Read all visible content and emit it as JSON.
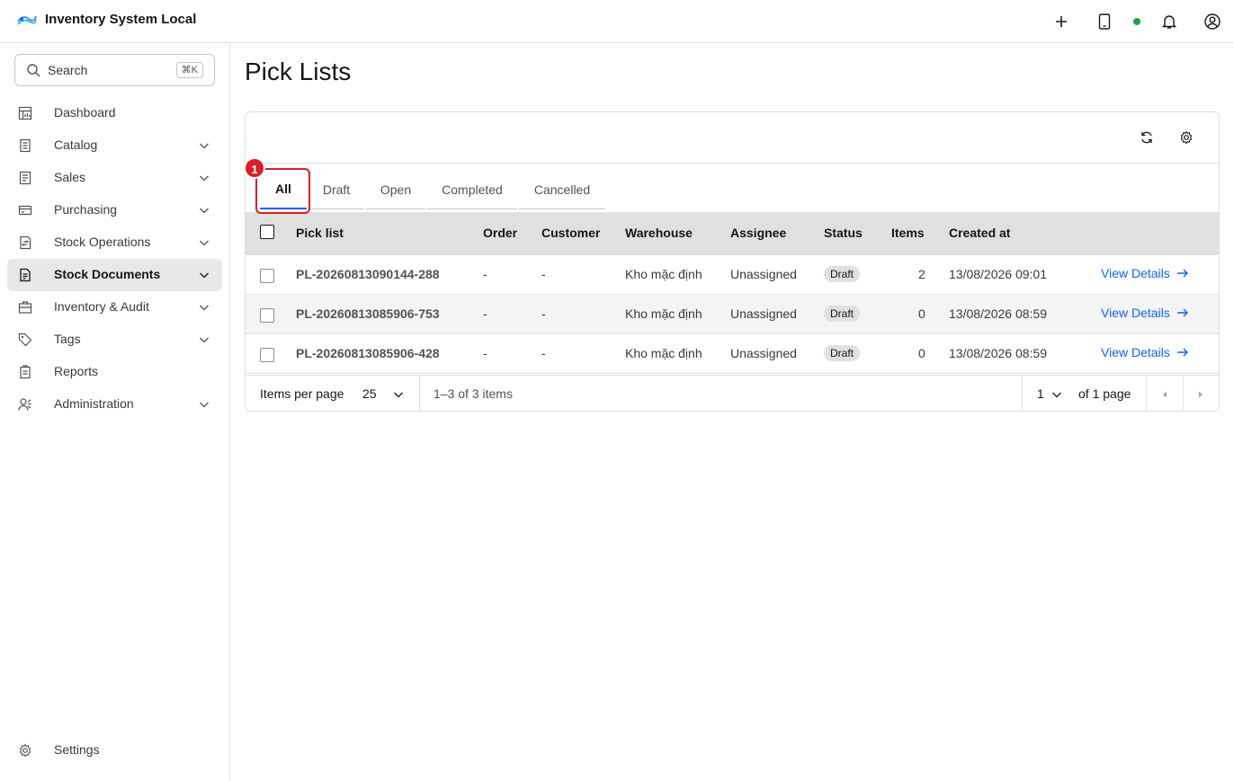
{
  "header": {
    "title": "Inventory System Local",
    "icons": [
      "plus-icon",
      "tablet-icon",
      "notification-icon",
      "user-avatar-icon"
    ],
    "status_color": "#24a148"
  },
  "sidebar": {
    "search": {
      "label": "Search",
      "shortcut": "⌘K"
    },
    "items": [
      {
        "label": "Dashboard",
        "icon": "dashboard-icon",
        "expandable": false
      },
      {
        "label": "Catalog",
        "icon": "catalog-icon",
        "expandable": true
      },
      {
        "label": "Sales",
        "icon": "sales-icon",
        "expandable": true
      },
      {
        "label": "Purchasing",
        "icon": "purchasing-icon",
        "expandable": true
      },
      {
        "label": "Stock Operations",
        "icon": "stock-operations-icon",
        "expandable": true
      },
      {
        "label": "Stock Documents",
        "icon": "stock-documents-icon",
        "expandable": true,
        "active": true
      },
      {
        "label": "Inventory & Audit",
        "icon": "inventory-audit-icon",
        "expandable": true
      },
      {
        "label": "Tags",
        "icon": "tag-icon",
        "expandable": true
      },
      {
        "label": "Reports",
        "icon": "reports-icon",
        "expandable": false
      },
      {
        "label": "Administration",
        "icon": "administration-icon",
        "expandable": true
      }
    ],
    "settings_label": "Settings"
  },
  "main": {
    "title": "Pick Lists",
    "annotation_number": "1",
    "tabs": [
      {
        "label": "All",
        "active": true
      },
      {
        "label": "Draft"
      },
      {
        "label": "Open"
      },
      {
        "label": "Completed"
      },
      {
        "label": "Cancelled"
      }
    ],
    "columns": [
      "Pick list",
      "Order",
      "Customer",
      "Warehouse",
      "Assignee",
      "Status",
      "Items",
      "Created at"
    ],
    "rows": [
      {
        "pick_list": "PL-20260813090144-288",
        "order": "-",
        "customer": "-",
        "warehouse": "Kho mặc định",
        "assignee": "Unassigned",
        "status": "Draft",
        "items": "2",
        "created_at": "13/08/2026 09:01",
        "action": "View Details"
      },
      {
        "pick_list": "PL-20260813085906-753",
        "order": "-",
        "customer": "-",
        "warehouse": "Kho mặc định",
        "assignee": "Unassigned",
        "status": "Draft",
        "items": "0",
        "created_at": "13/08/2026 08:59",
        "action": "View Details"
      },
      {
        "pick_list": "PL-20260813085906-428",
        "order": "-",
        "customer": "-",
        "warehouse": "Kho mặc định",
        "assignee": "Unassigned",
        "status": "Draft",
        "items": "0",
        "created_at": "13/08/2026 08:59",
        "action": "View Details"
      }
    ],
    "pagination": {
      "items_per_page_label": "Items per page",
      "items_per_page": "25",
      "range_text": "1–3 of 3 items",
      "current_page": "1",
      "page_total_text": "of 1 page"
    }
  }
}
